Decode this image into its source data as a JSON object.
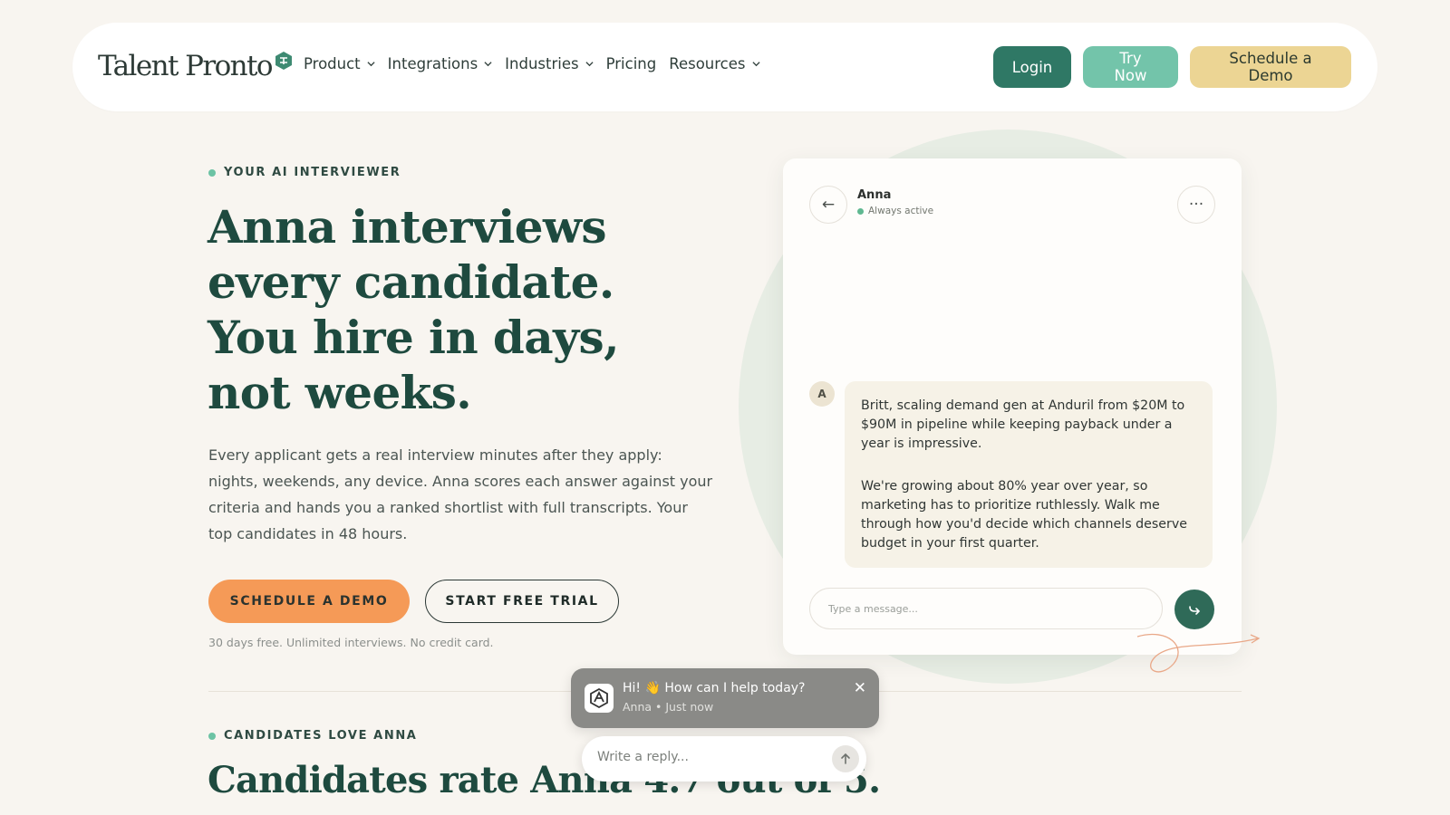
{
  "brand": {
    "logo_text": "Talent Pronto",
    "accent": "#2f7865",
    "cta_color": "#f59a57"
  },
  "nav": {
    "items": [
      {
        "label": "Product",
        "has_dropdown": true
      },
      {
        "label": "Integrations",
        "has_dropdown": true
      },
      {
        "label": "Industries",
        "has_dropdown": true
      },
      {
        "label": "Pricing",
        "has_dropdown": false
      },
      {
        "label": "Resources",
        "has_dropdown": true
      }
    ],
    "login_label": "Login",
    "try_label": "Try Now",
    "demo_label": "Schedule a Demo"
  },
  "hero": {
    "eyebrow": "YOUR AI INTERVIEWER",
    "title": "Anna interviews every candidate. You hire in days, not weeks.",
    "description": "Every applicant gets a real interview minutes after they apply: nights, weekends, any device. Anna scores each answer against your criteria and hands you a ranked shortlist with full transcripts. Your top candidates in 48 hours.",
    "cta_primary": "SCHEDULE A DEMO",
    "cta_secondary": "START FREE TRIAL",
    "fineprint": "30 days free. Unlimited interviews. No credit card."
  },
  "chat": {
    "back_icon": "←",
    "more_icon": "···",
    "agent_name": "Anna",
    "agent_status": "Always active",
    "avatar_initial": "A",
    "messages": [
      "Britt, scaling demand gen at Anduril from $20M to $90M in pipeline while keeping payback under a year is impressive.",
      "We're growing about 80% year over year, so marketing has to prioritize ruthlessly. Walk me through how you'd decide which channels deserve budget in your first quarter."
    ],
    "input_placeholder": "Type a message..."
  },
  "section2": {
    "eyebrow": "CANDIDATES LOVE ANNA",
    "title": "Candidates rate Anna 4.7 out of 5."
  },
  "widget": {
    "greeting": "Hi! 👋 How can I help today?",
    "sub": "Anna • Just now",
    "close_icon": "✕",
    "reply_placeholder": "Write a reply..."
  }
}
